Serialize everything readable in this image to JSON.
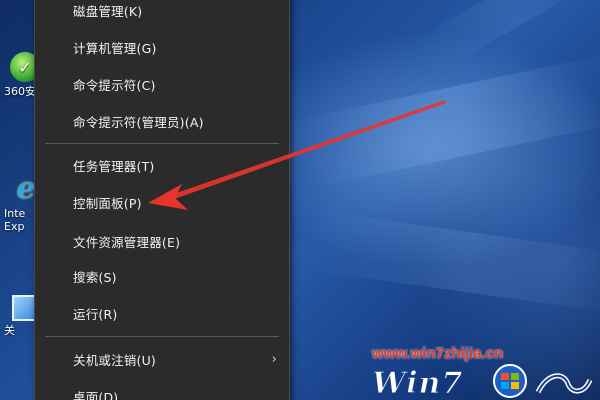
{
  "desktop": {
    "icons": [
      {
        "label": "360安"
      },
      {
        "label": "Inte\nExp"
      },
      {
        "label": "关"
      }
    ]
  },
  "context_menu": {
    "items": [
      {
        "label": "磁盘管理(K)"
      },
      {
        "label": "计算机管理(G)"
      },
      {
        "label": "命令提示符(C)"
      },
      {
        "label": "命令提示符(管理员)(A)"
      },
      {
        "label": "任务管理器(T)"
      },
      {
        "label": "控制面板(P)"
      },
      {
        "label": "文件资源管理器(E)"
      },
      {
        "label": "搜索(S)"
      },
      {
        "label": "运行(R)"
      },
      {
        "label": "关机或注销(U)"
      },
      {
        "label": "桌面(D)"
      }
    ],
    "submenu_arrow": "›"
  },
  "annotation": {
    "color": "#e8342f",
    "points_to": "控制面板(P)"
  },
  "watermark": {
    "url": "www.win7zhijia.cn",
    "logo_text": "Win7",
    "url_color": "#e53a2a"
  },
  "colors": {
    "menu_background": "#2b2b2b",
    "menu_text": "#f2f2f2",
    "wallpaper_accent": "#275aa8"
  }
}
